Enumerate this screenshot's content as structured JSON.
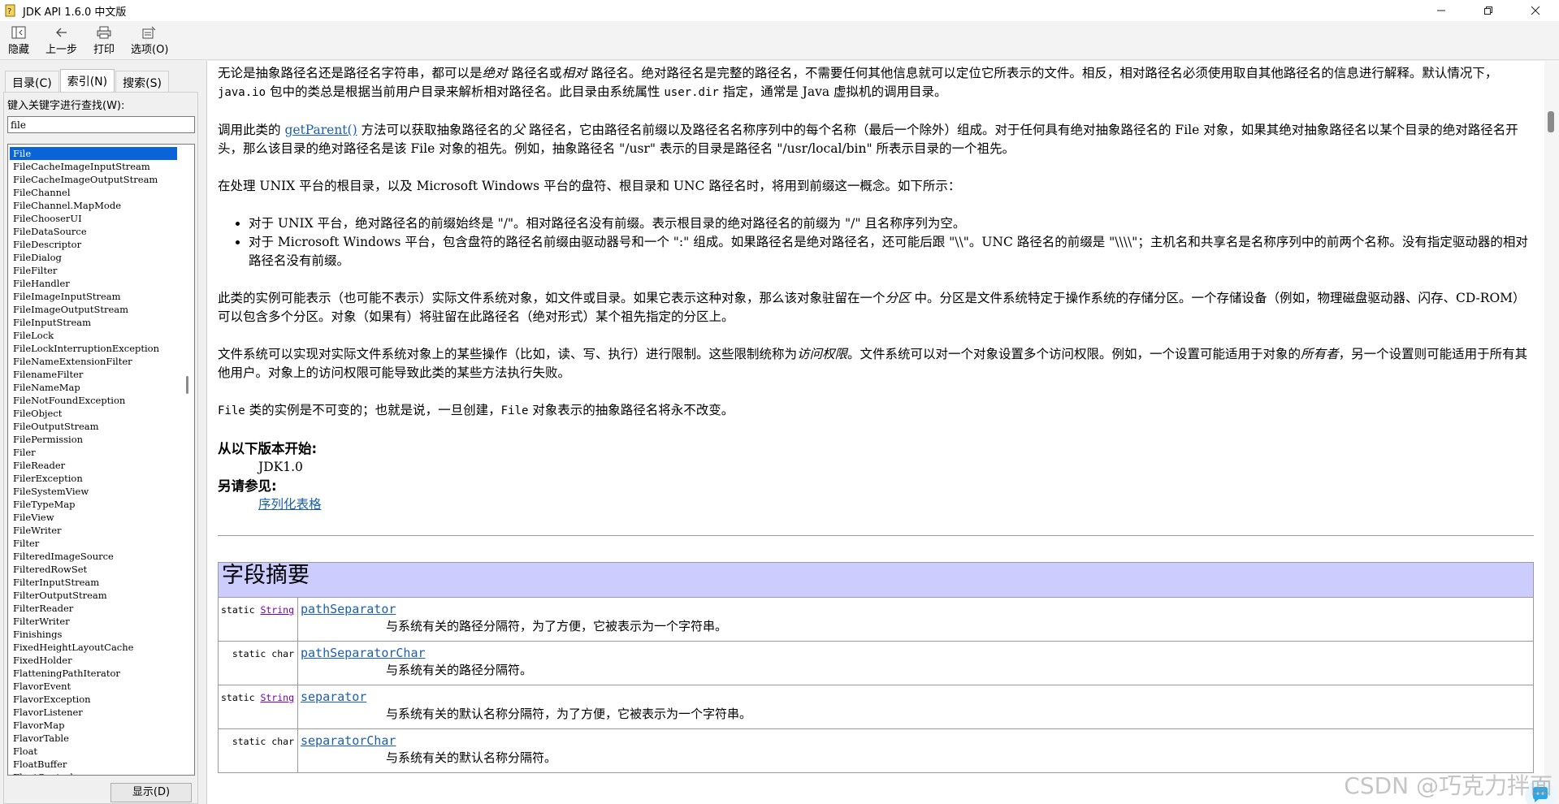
{
  "window": {
    "title": "JDK API 1.6.0 中文版"
  },
  "toolbar": {
    "hide_label": "隐藏",
    "back_label": "上一步",
    "print_label": "打印",
    "options_label": "选项(O)"
  },
  "left": {
    "tabs": [
      "目录(C)",
      "索引(N)",
      "搜索(S)"
    ],
    "keyword_label": "键入关键字进行查找(W):",
    "keyword_value": "file",
    "items": [
      "File",
      "FileCacheImageInputStream",
      "FileCacheImageOutputStream",
      "FileChannel",
      "FileChannel.MapMode",
      "FileChooserUI",
      "FileDataSource",
      "FileDescriptor",
      "FileDialog",
      "FileFilter",
      "FileHandler",
      "FileImageInputStream",
      "FileImageOutputStream",
      "FileInputStream",
      "FileLock",
      "FileLockInterruptionException",
      "FileNameExtensionFilter",
      "FilenameFilter",
      "FileNameMap",
      "FileNotFoundException",
      "FileObject",
      "FileOutputStream",
      "FilePermission",
      "Filer",
      "FileReader",
      "FilerException",
      "FileSystemView",
      "FileTypeMap",
      "FileView",
      "FileWriter",
      "Filter",
      "FilteredImageSource",
      "FilteredRowSet",
      "FilterInputStream",
      "FilterOutputStream",
      "FilterReader",
      "FilterWriter",
      "Finishings",
      "FixedHeightLayoutCache",
      "FixedHolder",
      "FlatteningPathIterator",
      "FlavorEvent",
      "FlavorException",
      "FlavorListener",
      "FlavorMap",
      "FlavorTable",
      "Float",
      "FloatBuffer",
      "FloatControl"
    ],
    "display_button": "显示(D)"
  },
  "content": {
    "p1": {
      "a": "无论是抽象路径名还是路径名字符串，都可以是",
      "b": "绝对",
      "c": " 路径名或",
      "d": "相对",
      "e": " 路径名。绝对路径名是完整的路径名，不需要任何其他信息就可以定位它所表示的文件。相反，相对路径名必须使用取自其他路径名的信息进行解释。默认情况下，",
      "f": "java.io",
      "g": " 包中的类总是根据当前用户目录来解析相对路径名。此目录由系统属性 ",
      "h": "user.dir",
      "i": " 指定，通常是 Java 虚拟机的调用目录。"
    },
    "p2": {
      "a": "调用此类的 ",
      "link": "getParent()",
      "b": " 方法可以获取抽象路径名的",
      "c": "父",
      "d": " 路径名，它由路径名前缀以及路径名名称序列中的每个名称（最后一个除外）组成。对于任何具有绝对抽象路径名的 File 对象，如果其绝对抽象路径名以某个目录的绝对路径名开头，那么该目录的绝对路径名是该 File 对象的祖先。例如，抽象路径名 \"/usr\" 表示的目录是路径名 \"/usr/local/bin\" 所表示目录的一个祖先。"
    },
    "p3": "在处理 UNIX 平台的根目录，以及 Microsoft Windows 平台的盘符、根目录和 UNC 路径名时，将用到前缀这一概念。如下所示：",
    "bullets": [
      "对于 UNIX 平台，绝对路径名的前缀始终是 \"/\"。相对路径名没有前缀。表示根目录的绝对路径名的前缀为 \"/\" 且名称序列为空。",
      "对于 Microsoft Windows 平台，包含盘符的路径名前缀由驱动器号和一个 \":\" 组成。如果路径名是绝对路径名，还可能后跟 \"\\\\\"。UNC 路径名的前缀是 \"\\\\\\\\\"；主机名和共享名是名称序列中的前两个名称。没有指定驱动器的相对路径名没有前缀。"
    ],
    "p4": {
      "a": "此类的实例可能表示（也可能不表示）实际文件系统对象，如文件或目录。如果它表示这种对象，那么该对象驻留在一个",
      "b": "分区",
      "c": " 中。分区是文件系统特定于操作系统的存储分区。一个存储设备（例如，物理磁盘驱动器、闪存、CD-ROM）可以包含多个分区。对象（如果有）将驻留在此路径名（绝对形式）某个祖先指定的分区上。"
    },
    "p5": {
      "a": "文件系统可以实现对实际文件系统对象上的某些操作（比如，读、写、执行）进行限制。这些限制统称为",
      "b": "访问权限",
      "c": "。文件系统可以对一个对象设置多个访问权限。例如，一个设置可能适用于对象的",
      "d": "所有者",
      "e": "，另一个设置则可能适用于所有其他用户。对象上的访问权限可能导致此类的某些方法执行失败。"
    },
    "p6": {
      "a": "File",
      "b": " 类的实例是不可变的；也就是说，一旦创建，",
      "c": "File",
      "d": " 对象表示的抽象路径名将永不改变。"
    },
    "since_label": "从以下版本开始:",
    "since_value": "JDK1.0",
    "see_label": "另请参见:",
    "see_link": "序列化表格"
  },
  "summary": {
    "title": "字段摘要",
    "rows": [
      {
        "mod": "static",
        "type": "String",
        "typelink": true,
        "name": "pathSeparator",
        "desc": "与系统有关的路径分隔符，为了方便，它被表示为一个字符串。"
      },
      {
        "mod": "static",
        "type": "char",
        "typelink": false,
        "name": "pathSeparatorChar",
        "desc": "与系统有关的路径分隔符。"
      },
      {
        "mod": "static",
        "type": "String",
        "typelink": true,
        "name": "separator",
        "desc": "与系统有关的默认名称分隔符，为了方便，它被表示为一个字符串。"
      },
      {
        "mod": "static",
        "type": "char",
        "typelink": false,
        "name": "separatorChar",
        "desc": "与系统有关的默认名称分隔符。"
      }
    ]
  },
  "watermark": "CSDN @巧克力拌面",
  "colors": {
    "selected": "#0a64d8",
    "link": "#1a5fb4",
    "table_header": "#ccccff",
    "type_link": "#7a00a8"
  }
}
